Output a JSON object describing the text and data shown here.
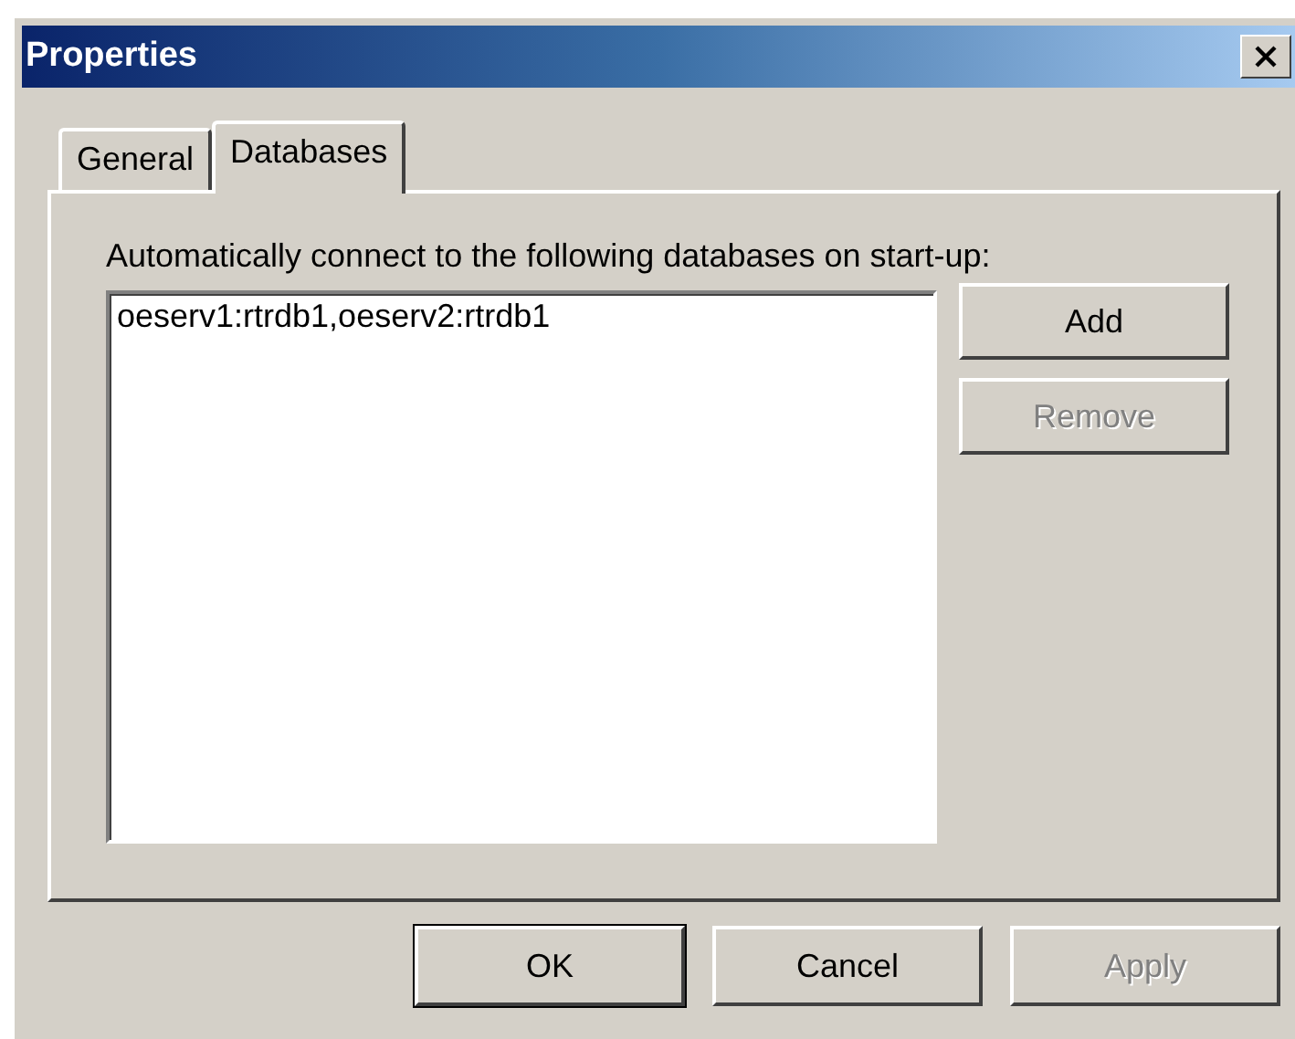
{
  "window": {
    "title": "Properties"
  },
  "tabs": [
    {
      "label": "General",
      "selected": false
    },
    {
      "label": "Databases",
      "selected": true
    }
  ],
  "panel": {
    "label": "Automatically connect to the following databases on start-up:",
    "list": {
      "items": [
        "oeserv1:rtrdb1,oeserv2:rtrdb1"
      ]
    },
    "buttons": [
      {
        "label": "Add",
        "disabled": false
      },
      {
        "label": "Remove",
        "disabled": true
      }
    ]
  },
  "buttons": [
    {
      "label": "OK",
      "default": true,
      "disabled": false
    },
    {
      "label": "Cancel",
      "default": false,
      "disabled": false
    },
    {
      "label": "Apply",
      "default": false,
      "disabled": true
    }
  ]
}
